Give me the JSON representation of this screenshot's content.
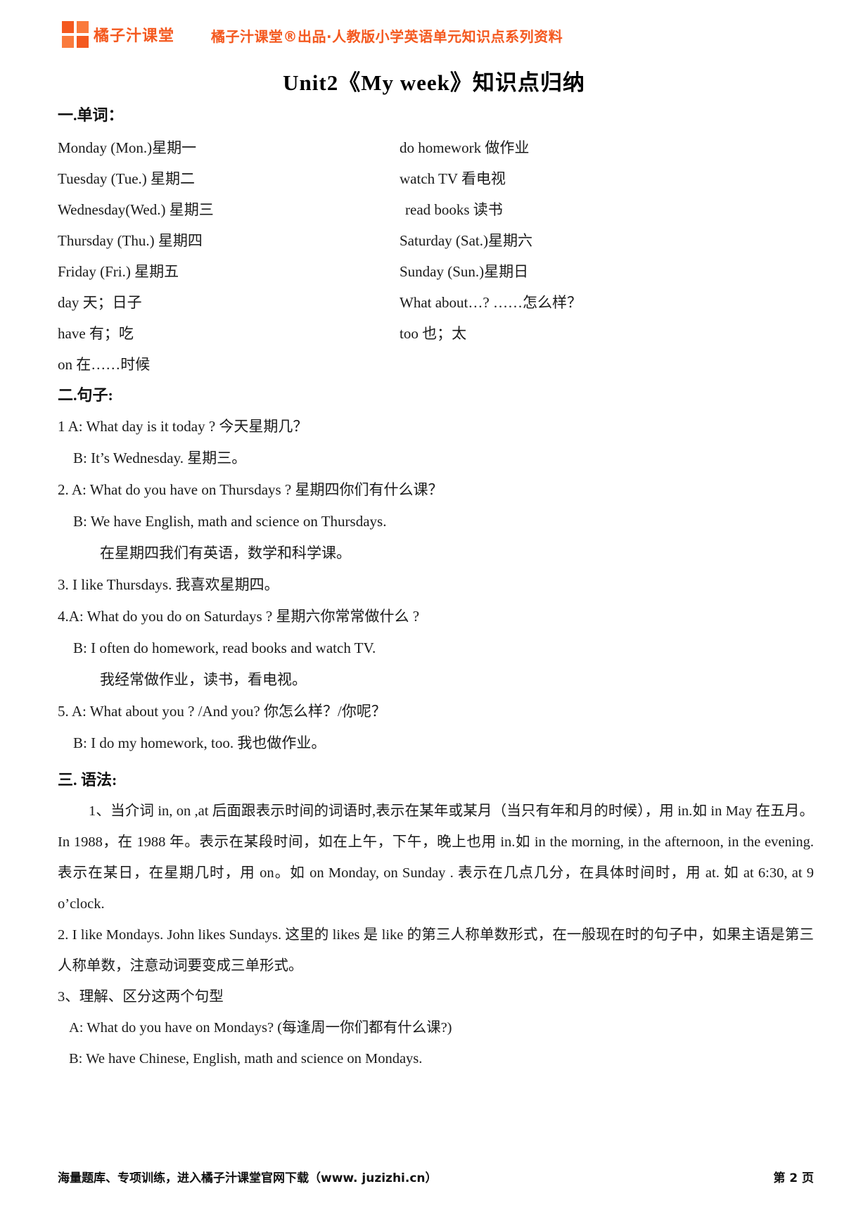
{
  "header": {
    "logo_name": "橘子汁课堂",
    "tagline": "橘子汁课堂®出品·人教版小学英语单元知识点系列资料",
    "brand_color": "#f4591f"
  },
  "doc_title": "Unit2《My week》知识点归纳",
  "sections": {
    "vocab_heading": "一.单词：",
    "sentences_heading": "二.句子:",
    "grammar_heading": "三. 语法:"
  },
  "vocabulary": [
    {
      "left": "Monday (Mon.)星期一",
      "right": "do homework 做作业"
    },
    {
      "left": "Tuesday (Tue.) 星期二",
      "right": "watch TV 看电视"
    },
    {
      "left": "Wednesday(Wed.) 星期三",
      "right": "read books 读书"
    },
    {
      "left": "Thursday (Thu.) 星期四",
      "right": "Saturday (Sat.)星期六"
    },
    {
      "left": "Friday (Fri.) 星期五",
      "right": "Sunday (Sun.)星期日"
    },
    {
      "left": "day 天；日子",
      "right": "What about…? ……怎么样？"
    },
    {
      "left": "have 有；吃",
      "right": "too 也；太"
    },
    {
      "left": "on 在……时候",
      "right": ""
    }
  ],
  "sentences": [
    {
      "indent": 0,
      "text": "1 A: What day is it today ?     今天星期几？"
    },
    {
      "indent": 1,
      "text": "B: It’s Wednesday.    星期三。"
    },
    {
      "indent": 0,
      "text": "2. A: What do you have on Thursdays ?  星期四你们有什么课？"
    },
    {
      "indent": 1,
      "text": "B: We have English, math and science on Thursdays."
    },
    {
      "indent": 2,
      "text": "在星期四我们有英语，数学和科学课。"
    },
    {
      "indent": 0,
      "text": "3. I like Thursdays.    我喜欢星期四。"
    },
    {
      "indent": 0,
      "text": "4.A:    What do you do on Saturdays ?      星期六你常常做什么 ?"
    },
    {
      "indent": 1,
      "text": "B:   I often do homework, read books and watch TV."
    },
    {
      "indent": 2,
      "text": "我经常做作业，读书，看电视。"
    },
    {
      "indent": 0,
      "text": "5. A: What about you ? /And you?     你怎么样？/你呢？"
    },
    {
      "indent": 1,
      "text": "B: I do my homework, too. 我也做作业。"
    }
  ],
  "grammar": [
    {
      "style": "indent",
      "text": "1、当介词 in, on ,at 后面跟表示时间的词语时,表示在某年或某月（当只有年和月的时候），用 in.如 in May 在五月。In 1988，在 1988 年。表示在某段时间，如在上午，下午，晚上也用 in.如 in the morning, in the afternoon, in the evening. 表示在某日，在星期几时，用 on。如 on Monday, on Sunday . 表示在几点几分，在具体时间时，用 at. 如 at 6:30,   at 9 o’clock."
    },
    {
      "style": "plain",
      "text": "2. I like Mondays. John likes Sundays. 这里的 likes 是 like 的第三人称单数形式，在一般现在时的句子中，如果主语是第三人称单数，注意动词要变成三单形式。"
    },
    {
      "style": "plain",
      "text": "3、理解、区分这两个句型"
    },
    {
      "style": "i1",
      "text": "A: What do you have on Mondays? (每逢周一你们都有什么课?)"
    },
    {
      "style": "i1",
      "text": "B: We have Chinese, English, math and science on  Mondays."
    }
  ],
  "footer": {
    "left": "海量题库、专项训练，进入橘子汁课堂官网下载（www. juzizhi.cn）",
    "page": "第 2 页"
  }
}
